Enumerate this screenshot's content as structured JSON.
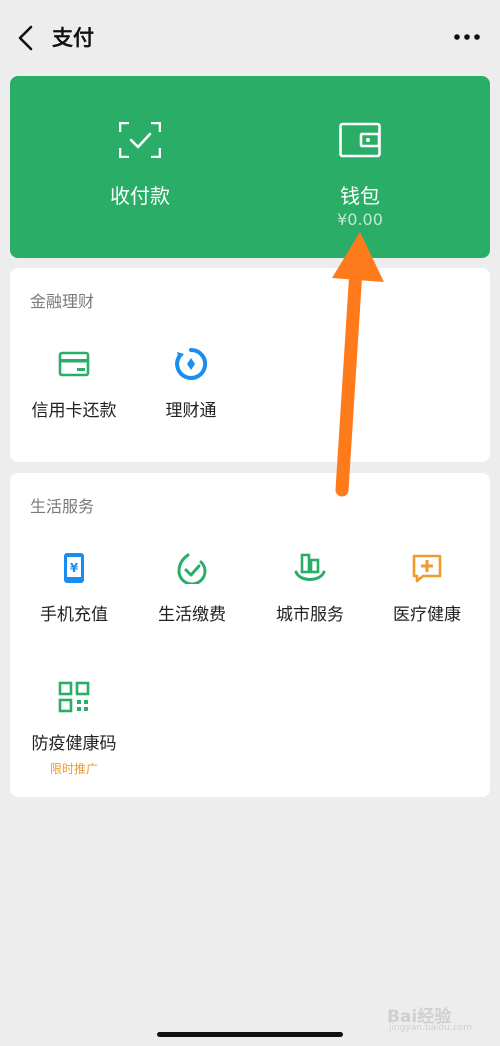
{
  "header": {
    "title": "支付",
    "back_icon": "chevron-left-icon",
    "more_icon": "more-dots-icon"
  },
  "wallet_card": {
    "bg_color": "#2aae67",
    "receive_pay": {
      "label": "收付款",
      "icon": "scan-check-icon"
    },
    "wallet": {
      "label": "钱包",
      "balance": "¥0.00",
      "icon": "wallet-icon"
    }
  },
  "finance": {
    "title": "金融理财",
    "items": [
      {
        "label": "信用卡还款",
        "icon": "credit-card-icon"
      },
      {
        "label": "理财通",
        "icon": "wealth-icon"
      }
    ]
  },
  "life": {
    "title": "生活服务",
    "items": [
      {
        "label": "手机充值",
        "icon": "phone-recharge-icon"
      },
      {
        "label": "生活缴费",
        "icon": "utility-payment-icon"
      },
      {
        "label": "城市服务",
        "icon": "city-service-icon"
      },
      {
        "label": "医疗健康",
        "icon": "medical-health-icon"
      },
      {
        "label": "防疫健康码",
        "icon": "health-qr-icon",
        "promo": "限时推广"
      }
    ]
  },
  "colors": {
    "accent_green": "#2aae67",
    "icon_blue": "#1a8df0",
    "icon_orange": "#ee9a2c",
    "arrow_orange": "#ff7a1a"
  },
  "watermark": {
    "text": "Bai经验",
    "sub": "jingyan.baidu.com"
  }
}
